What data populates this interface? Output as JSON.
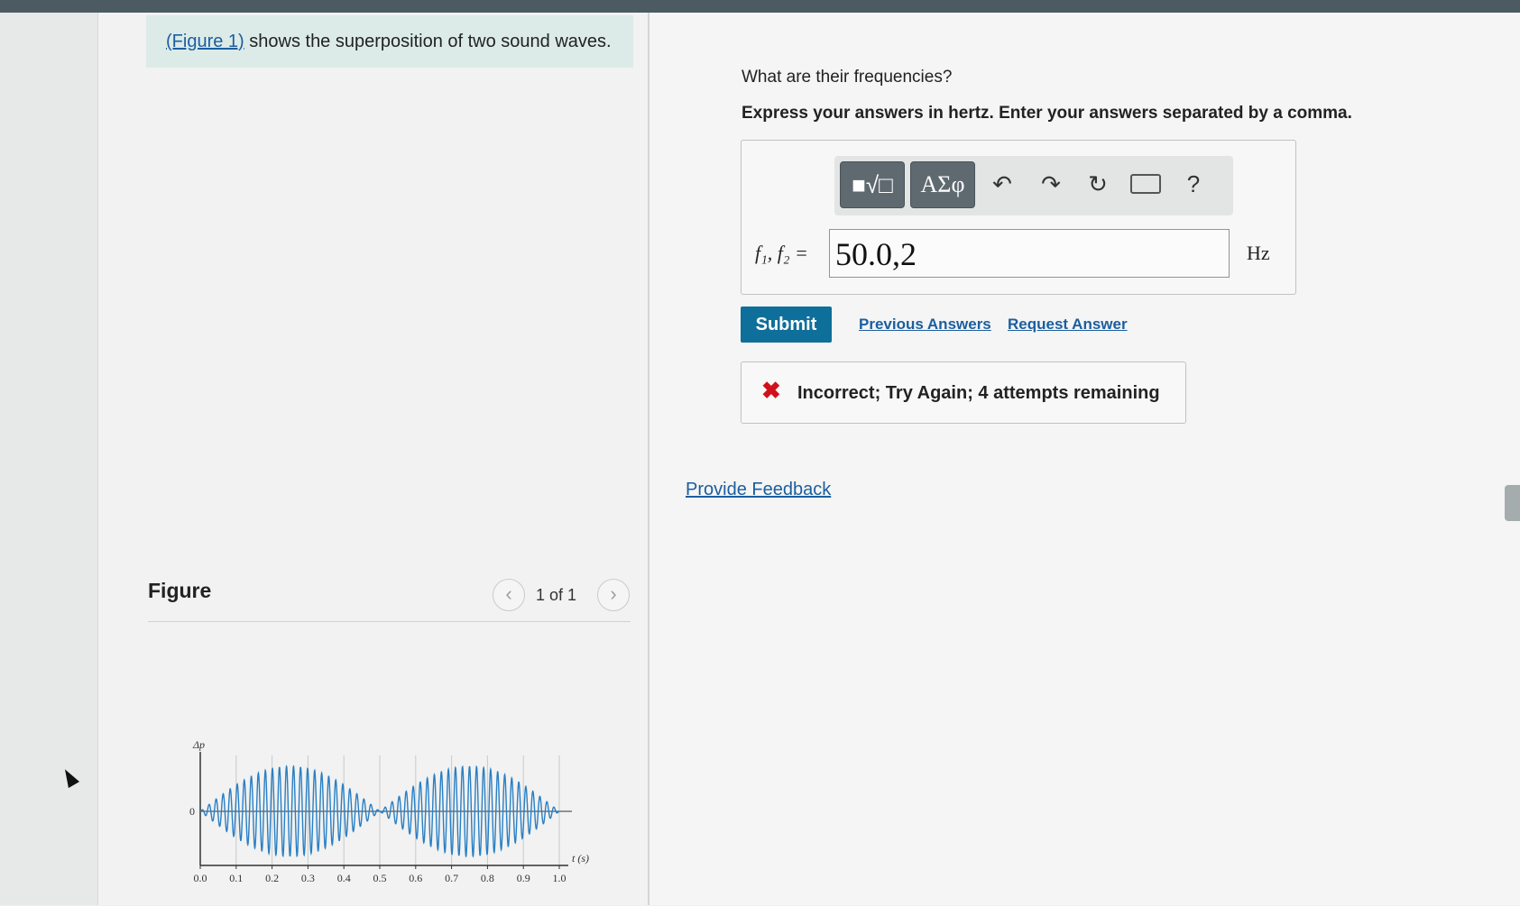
{
  "intro": {
    "link": "(Figure 1)",
    "text": " shows the superposition of two sound waves."
  },
  "question": {
    "prompt": "What are their frequencies?",
    "instructions": "Express your answers in hertz. Enter your answers separated by a comma."
  },
  "toolbar": {
    "template_icon": "■√□",
    "greek_label": "ΑΣφ",
    "undo_icon": "↶",
    "redo_icon": "↷",
    "reset_icon": "↻",
    "keyboard_icon": "⌨",
    "help_label": "?"
  },
  "answer": {
    "variable_label": "f₁, f₂ =",
    "value": "50.0,2",
    "unit": "Hz"
  },
  "actions": {
    "submit": "Submit",
    "previous_answers": "Previous Answers",
    "request_answer": "Request Answer"
  },
  "feedback": {
    "icon": "✖",
    "message": "Incorrect; Try Again; 4 attempts remaining"
  },
  "provide_feedback": "Provide Feedback",
  "figure": {
    "title": "Figure",
    "prev_icon": "‹",
    "next_icon": "›",
    "count": "1 of 1"
  },
  "chart_data": {
    "type": "line",
    "ylabel": "Δp",
    "xlabel": "t (s)",
    "y_tick_labels": [
      "0"
    ],
    "x_ticks": [
      0.0,
      0.1,
      0.2,
      0.3,
      0.4,
      0.5,
      0.6,
      0.7,
      0.8,
      0.9,
      1.0
    ],
    "x_tick_labels": [
      "0.0",
      "0.1",
      "0.2",
      "0.3",
      "0.4",
      "0.5",
      "0.6",
      "0.7",
      "0.8",
      "0.9",
      "1.0"
    ],
    "xlim": [
      0,
      1.0
    ],
    "ylim": [
      -1,
      1
    ],
    "grid": "vertical",
    "series": [
      {
        "carrier_cycles_per_second": 51,
        "envelope_beats_per_second": 2,
        "color": "#2a7fc4"
      }
    ]
  },
  "colors": {
    "accent": "#0e6f9a",
    "link": "#1b5e9f",
    "error": "#d0101a",
    "wave": "#2a7fc4"
  }
}
